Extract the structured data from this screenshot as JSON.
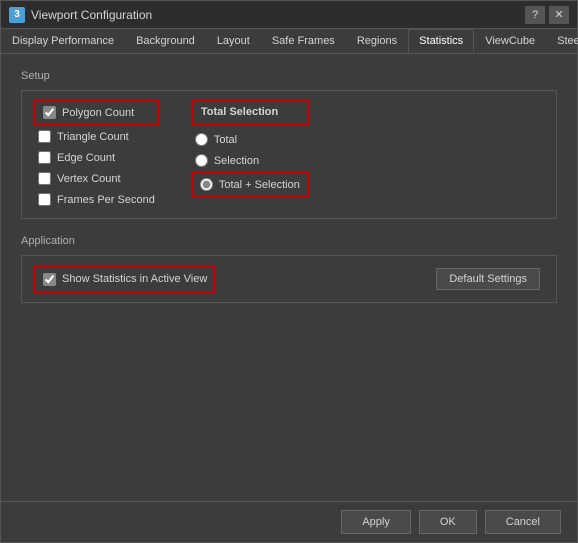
{
  "window": {
    "title": "Viewport Configuration",
    "icon": "3",
    "help_label": "?",
    "close_label": "✕"
  },
  "tabs": [
    {
      "id": "display-performance",
      "label": "Display Performance",
      "active": false
    },
    {
      "id": "background",
      "label": "Background",
      "active": false
    },
    {
      "id": "layout",
      "label": "Layout",
      "active": false
    },
    {
      "id": "safe-frames",
      "label": "Safe Frames",
      "active": false
    },
    {
      "id": "regions",
      "label": "Regions",
      "active": false
    },
    {
      "id": "statistics",
      "label": "Statistics",
      "active": true
    },
    {
      "id": "viewcube",
      "label": "ViewCube",
      "active": false
    },
    {
      "id": "steeringwheels",
      "label": "SteeringWheels",
      "active": false
    }
  ],
  "setup": {
    "section_label": "Setup",
    "checkboxes": [
      {
        "id": "polygon-count",
        "label": "Polygon Count",
        "checked": true,
        "highlighted": true
      },
      {
        "id": "triangle-count",
        "label": "Triangle Count",
        "checked": false,
        "highlighted": false
      },
      {
        "id": "edge-count",
        "label": "Edge Count",
        "checked": false,
        "highlighted": false
      },
      {
        "id": "vertex-count",
        "label": "Vertex Count",
        "checked": false,
        "highlighted": false
      },
      {
        "id": "frames-per-second",
        "label": "Frames Per Second",
        "checked": false,
        "highlighted": false
      }
    ],
    "radios": [
      {
        "id": "total",
        "label": "Total",
        "checked": false
      },
      {
        "id": "selection",
        "label": "Selection",
        "checked": false
      },
      {
        "id": "total-plus-selection",
        "label": "Total + Selection",
        "checked": true,
        "highlighted": true
      }
    ],
    "total_selection_header": "Total Selection"
  },
  "application": {
    "section_label": "Application",
    "show_statistics_label": "Show Statistics in Active View",
    "show_statistics_checked": true,
    "show_statistics_highlighted": true,
    "default_settings_label": "Default Settings"
  },
  "footer": {
    "apply_label": "Apply",
    "ok_label": "OK",
    "cancel_label": "Cancel"
  }
}
